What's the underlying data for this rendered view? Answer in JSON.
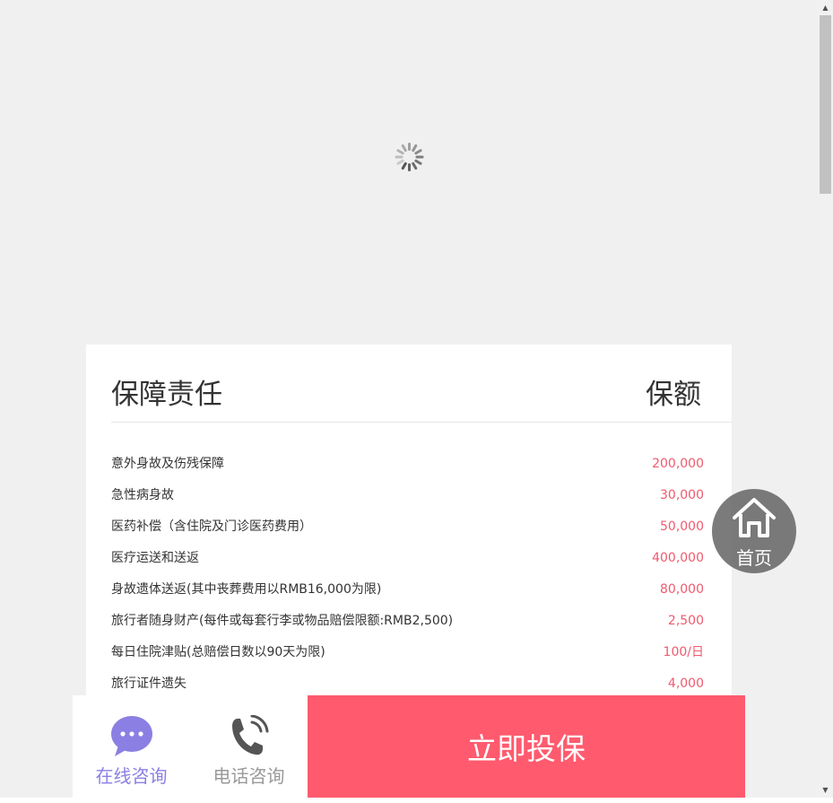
{
  "coverage_table": {
    "header_left": "保障责任",
    "header_right": "保额",
    "rows": [
      {
        "name": "意外身故及伤残保障",
        "amount": "200,000"
      },
      {
        "name": "急性病身故",
        "amount": "30,000"
      },
      {
        "name": "医药补偿（含住院及门诊医药费用）",
        "amount": "50,000"
      },
      {
        "name": "医疗运送和送返",
        "amount": "400,000"
      },
      {
        "name": "身故遗体送返(其中丧葬费用以RMB16,000为限)",
        "amount": "80,000"
      },
      {
        "name": "旅行者随身财产(每件或每套行李或物品赔偿限额:RMB2,500)",
        "amount": "2,500"
      },
      {
        "name": "每日住院津贴(总赔偿日数以90天为限)",
        "amount": "100/日"
      },
      {
        "name": "旅行证件遗失",
        "amount": "4,000"
      }
    ]
  },
  "home_button": {
    "label": "首页",
    "icon": "home-icon"
  },
  "bottom_bar": {
    "online_consult": {
      "label": "在线咨询",
      "icon": "chat-bubble-icon"
    },
    "phone_consult": {
      "label": "电话咨询",
      "icon": "phone-icon"
    },
    "buy_now": {
      "label": "立即投保"
    }
  },
  "colors": {
    "accent": "#ff5a6e",
    "amount_text": "#f05a6e",
    "online_consult": "#8b7fe3"
  }
}
